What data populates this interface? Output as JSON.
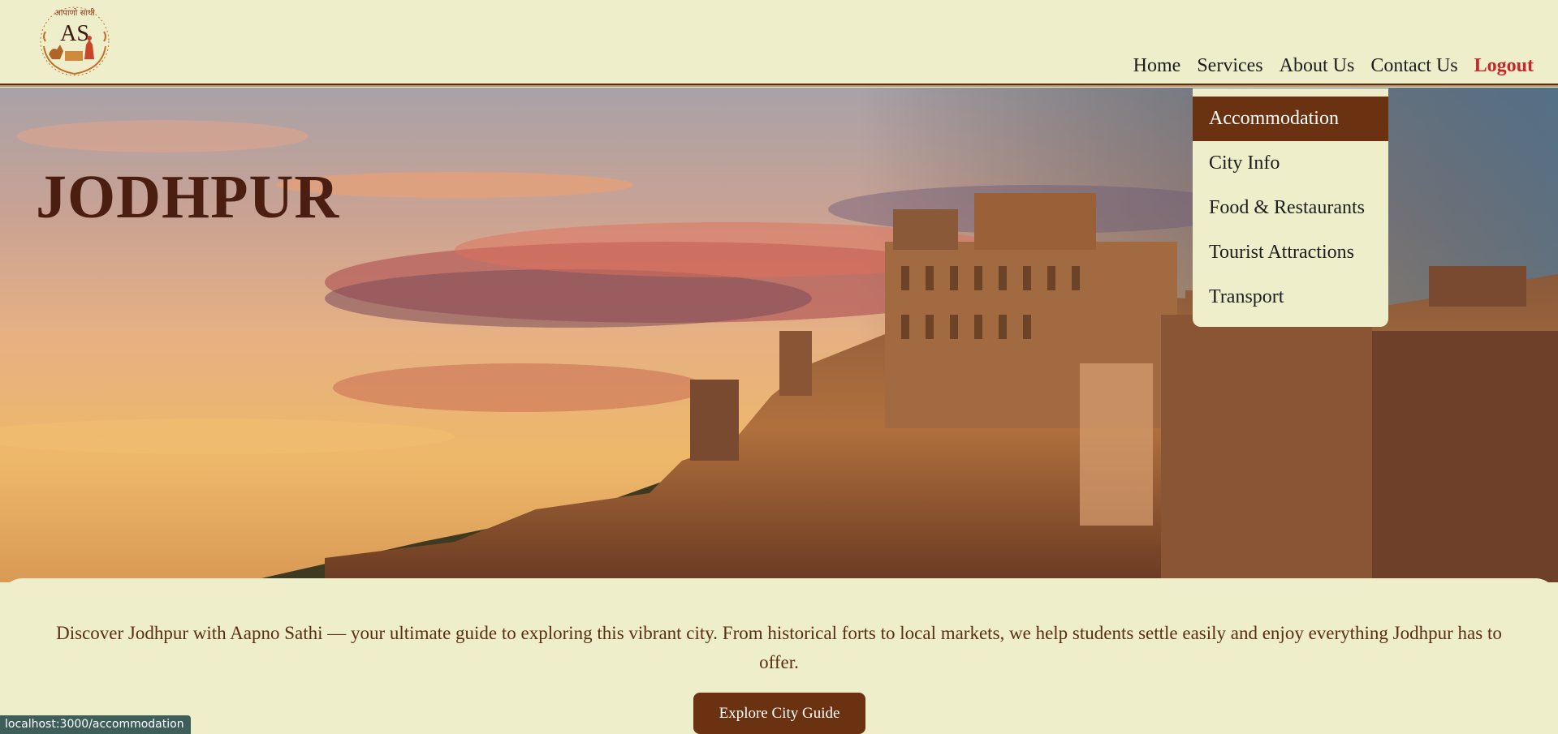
{
  "header": {
    "logo": {
      "text": "AS",
      "tagline": "आपाणो साथी"
    },
    "nav": [
      {
        "label": "Home"
      },
      {
        "label": "Services"
      },
      {
        "label": "About Us"
      },
      {
        "label": "Contact Us"
      },
      {
        "label": "Logout"
      }
    ]
  },
  "services_menu": [
    {
      "label": "Accommodation",
      "active": true
    },
    {
      "label": "City Info"
    },
    {
      "label": "Food & Restaurants"
    },
    {
      "label": "Tourist Attractions"
    },
    {
      "label": "Transport"
    }
  ],
  "hero": {
    "title": "JODHPUR"
  },
  "intro": {
    "text": "Discover Jodhpur with Aapno Sathi — your ultimate guide to exploring this vibrant city. From historical forts to local markets, we help students settle easily and enjoy everything Jodhpur has to offer.",
    "cta": "Explore City Guide"
  },
  "status_bar": {
    "url": "localhost:3000/accommodation"
  },
  "colors": {
    "background": "#eeefca",
    "accent": "#6b3212",
    "logout": "#c8262a",
    "text": "#5a2e12"
  }
}
